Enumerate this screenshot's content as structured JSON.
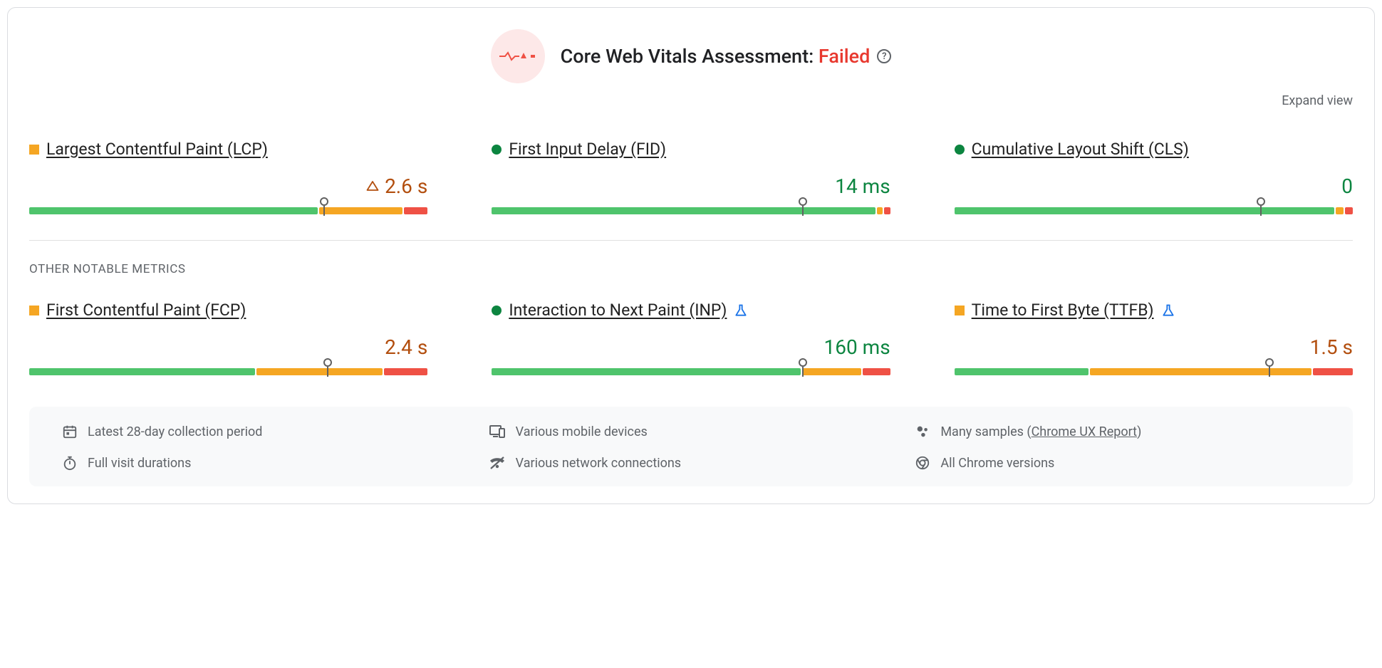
{
  "assessment": {
    "title_prefix": "Core Web Vitals Assessment: ",
    "status": "Failed",
    "status_color": "#e8382e"
  },
  "expand_label": "Expand view",
  "section_label": "OTHER NOTABLE METRICS",
  "colors": {
    "good": "#4fc46c",
    "warn": "#f5a623",
    "bad": "#ef5145",
    "warn_square": "#f5a623",
    "good_circle": "#0c8540",
    "value_good": "#0c8540",
    "value_warn": "#b24e0e"
  },
  "core_metrics": [
    {
      "id": "lcp",
      "name": "Largest Contentful Paint (LCP)",
      "status": "warn",
      "value": "2.6 s",
      "has_warn_icon": true,
      "flask": false,
      "segments": [
        73,
        21,
        6
      ],
      "marker_pct": 74
    },
    {
      "id": "fid",
      "name": "First Input Delay (FID)",
      "status": "good",
      "value": "14 ms",
      "has_warn_icon": false,
      "flask": false,
      "segments": [
        97,
        1.5,
        1.5
      ],
      "marker_pct": 78
    },
    {
      "id": "cls",
      "name": "Cumulative Layout Shift (CLS)",
      "status": "good",
      "value": "0",
      "has_warn_icon": false,
      "flask": false,
      "segments": [
        96,
        2,
        2
      ],
      "marker_pct": 77
    }
  ],
  "other_metrics": [
    {
      "id": "fcp",
      "name": "First Contentful Paint (FCP)",
      "status": "warn",
      "value": "2.4 s",
      "has_warn_icon": false,
      "flask": false,
      "segments": [
        57,
        32,
        11
      ],
      "marker_pct": 75
    },
    {
      "id": "inp",
      "name": "Interaction to Next Paint (INP)",
      "status": "good",
      "value": "160 ms",
      "has_warn_icon": false,
      "flask": true,
      "segments": [
        78,
        15,
        7
      ],
      "marker_pct": 78
    },
    {
      "id": "ttfb",
      "name": "Time to First Byte (TTFB)",
      "status": "warn",
      "value": "1.5 s",
      "has_warn_icon": false,
      "flask": true,
      "segments": [
        34,
        56,
        10
      ],
      "marker_pct": 79
    }
  ],
  "footer": {
    "collection": "Latest 28-day collection period",
    "devices": "Various mobile devices",
    "samples_prefix": "Many samples (",
    "samples_link": "Chrome UX Report",
    "samples_suffix": ")",
    "durations": "Full visit durations",
    "network": "Various network connections",
    "chrome": "All Chrome versions"
  },
  "chart_data": [
    {
      "type": "bar",
      "metric": "LCP",
      "title": "Largest Contentful Paint (LCP)",
      "value": "2.6 s",
      "status": "needs-improvement",
      "distribution_pct": {
        "good": 73,
        "needs_improvement": 21,
        "poor": 6
      },
      "marker_percentile": 75
    },
    {
      "type": "bar",
      "metric": "FID",
      "title": "First Input Delay (FID)",
      "value": "14 ms",
      "status": "good",
      "distribution_pct": {
        "good": 97,
        "needs_improvement": 1.5,
        "poor": 1.5
      },
      "marker_percentile": 75
    },
    {
      "type": "bar",
      "metric": "CLS",
      "title": "Cumulative Layout Shift (CLS)",
      "value": "0",
      "status": "good",
      "distribution_pct": {
        "good": 96,
        "needs_improvement": 2,
        "poor": 2
      },
      "marker_percentile": 75
    },
    {
      "type": "bar",
      "metric": "FCP",
      "title": "First Contentful Paint (FCP)",
      "value": "2.4 s",
      "status": "needs-improvement",
      "distribution_pct": {
        "good": 57,
        "needs_improvement": 32,
        "poor": 11
      },
      "marker_percentile": 75
    },
    {
      "type": "bar",
      "metric": "INP",
      "title": "Interaction to Next Paint (INP)",
      "value": "160 ms",
      "status": "good",
      "distribution_pct": {
        "good": 78,
        "needs_improvement": 15,
        "poor": 7
      },
      "marker_percentile": 75
    },
    {
      "type": "bar",
      "metric": "TTFB",
      "title": "Time to First Byte (TTFB)",
      "value": "1.5 s",
      "status": "needs-improvement",
      "distribution_pct": {
        "good": 34,
        "needs_improvement": 56,
        "poor": 10
      },
      "marker_percentile": 75
    }
  ]
}
